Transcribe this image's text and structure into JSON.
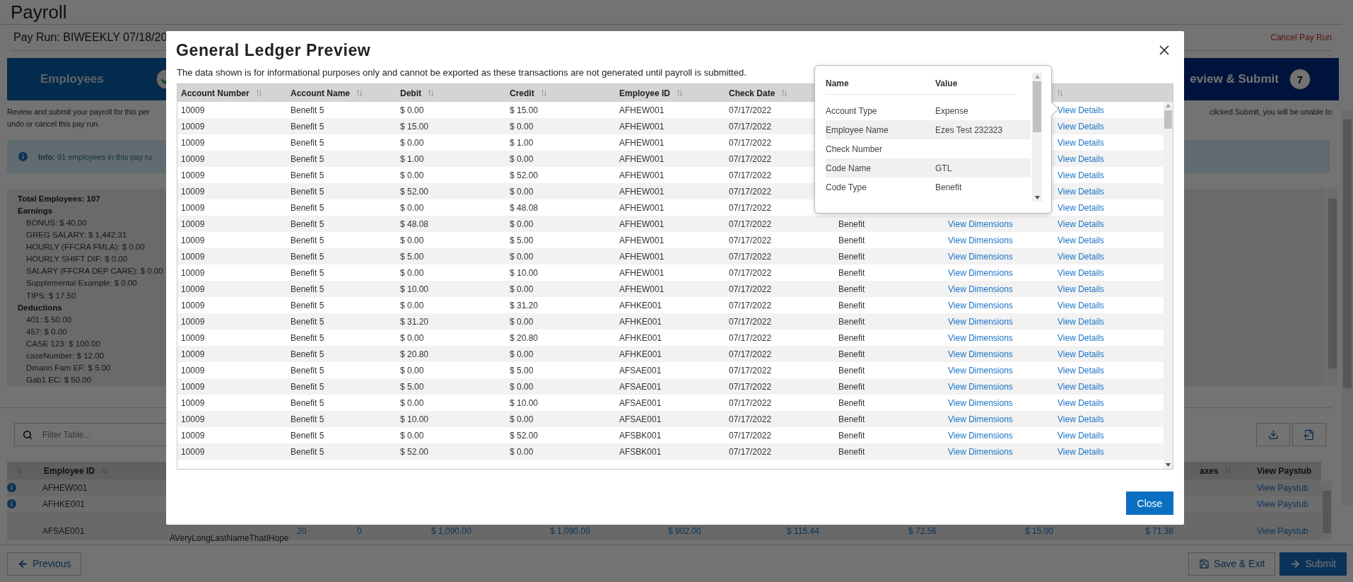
{
  "page": {
    "title": "Payroll"
  },
  "pay_run": {
    "title": "Pay Run: BIWEEKLY 07/18/20",
    "cancel_link": "Cancel Pay Run"
  },
  "steps": [
    {
      "label": "Employees",
      "completed": true
    },
    {
      "label": "eview & Submit",
      "number": "7",
      "completed": false
    }
  ],
  "intro_lines": [
    "Review and submit your payroll for this per",
    "undo or cancel this pay run."
  ],
  "intro_right": "clicked Submit, you will be unable to",
  "info": {
    "text": "**Info:** 91 employees in this pay ru"
  },
  "summary": {
    "total": "Total Employees: 107",
    "groups": [
      {
        "title": "Earnings",
        "items": [
          "BONUS: $ 40.00",
          "GREG SALARY: $ 1,442.31",
          "HOURLY (FFCRA FMLA): $ 0.00",
          "HOURLY SHIFT DIF: $ 0.00",
          "SALARY (FFCRA DEP CARE): $ 0.00",
          "Supplemental Example: $ 0.00",
          "TIPS: $ 17.50"
        ]
      },
      {
        "title": "Deductions",
        "items": [
          "401: $ 50.00",
          "457: $ 0.00",
          "CASE 123: $ 100.00",
          "caseNumber: $ 12.00",
          "Dmann Fam EF: $ 5.00",
          "Gab1 EC: $ 50.00"
        ]
      }
    ]
  },
  "filter": {
    "placeholder": "Filter Table..."
  },
  "employee_table": {
    "header": {
      "employee_id": "Employee ID",
      "taxes": "axes",
      "paystub": "View Paystub"
    },
    "rows": [
      {
        "flagged": true,
        "employee_id": "AFHEW001",
        "paystub_link": "View Paystub"
      },
      {
        "flagged": true,
        "employee_id": "AFHKE001",
        "paystub_link": "View Paystub"
      },
      {
        "flagged": false,
        "employee_id": "AFSAE001",
        "name": "AVeryLongLastNameThatIHope",
        "values": [
          "20",
          "0",
          "$ 1,090.00",
          "$ 1,090.00",
          "$ 902.00",
          "$ 115.44",
          "$ 72.56",
          "$ 15.00",
          "$ 71.38"
        ],
        "paystub_link": "View Paystub"
      }
    ]
  },
  "buttons": {
    "previous": "Previous",
    "save": "Save & Exit",
    "submit": "Submit"
  },
  "ledger_modal": {
    "title": "General Ledger Preview",
    "description": "The data shown is for informational purposes only and cannot be exported as these transactions are not generated until payroll is submitted.",
    "columns": [
      "Account Number",
      "Account Name",
      "Debit",
      "Credit",
      "Employee ID",
      "Check Date"
    ],
    "rows": [
      {
        "account_number": "10009",
        "account_name": "Benefit 5",
        "debit": "$ 0.00",
        "credit": "$ 15.00",
        "employee_id": "AFHEW001",
        "check_date": "07/17/2022",
        "details_link": "View Details"
      },
      {
        "account_number": "10009",
        "account_name": "Benefit 5",
        "debit": "$ 15.00",
        "credit": "$ 0.00",
        "employee_id": "AFHEW001",
        "check_date": "07/17/2022",
        "details_link": "View Details"
      },
      {
        "account_number": "10009",
        "account_name": "Benefit 5",
        "debit": "$ 0.00",
        "credit": "$ 1.00",
        "employee_id": "AFHEW001",
        "check_date": "07/17/2022",
        "details_link": "View Details"
      },
      {
        "account_number": "10009",
        "account_name": "Benefit 5",
        "debit": "$ 1.00",
        "credit": "$ 0.00",
        "employee_id": "AFHEW001",
        "check_date": "07/17/2022",
        "details_link": "View Details"
      },
      {
        "account_number": "10009",
        "account_name": "Benefit 5",
        "debit": "$ 0.00",
        "credit": "$ 52.00",
        "employee_id": "AFHEW001",
        "check_date": "07/17/2022",
        "details_link": "View Details"
      },
      {
        "account_number": "10009",
        "account_name": "Benefit 5",
        "debit": "$ 52.00",
        "credit": "$ 0.00",
        "employee_id": "AFHEW001",
        "check_date": "07/17/2022",
        "details_link": "View Details"
      },
      {
        "account_number": "10009",
        "account_name": "Benefit 5",
        "debit": "$ 0.00",
        "credit": "$ 48.08",
        "employee_id": "AFHEW001",
        "check_date": "07/17/2022",
        "details_link": "View Details"
      },
      {
        "account_number": "10009",
        "account_name": "Benefit 5",
        "debit": "$ 48.08",
        "credit": "$ 0.00",
        "employee_id": "AFHEW001",
        "check_date": "07/17/2022",
        "code_type": "Benefit",
        "dimensions_link": "View Dimensions",
        "details_link": "View Details"
      },
      {
        "account_number": "10009",
        "account_name": "Benefit 5",
        "debit": "$ 0.00",
        "credit": "$ 5.00",
        "employee_id": "AFHEW001",
        "check_date": "07/17/2022",
        "code_type": "Benefit",
        "dimensions_link": "View Dimensions",
        "details_link": "View Details"
      },
      {
        "account_number": "10009",
        "account_name": "Benefit 5",
        "debit": "$ 5.00",
        "credit": "$ 0.00",
        "employee_id": "AFHEW001",
        "check_date": "07/17/2022",
        "code_type": "Benefit",
        "dimensions_link": "View Dimensions",
        "details_link": "View Details"
      },
      {
        "account_number": "10009",
        "account_name": "Benefit 5",
        "debit": "$ 0.00",
        "credit": "$ 10.00",
        "employee_id": "AFHEW001",
        "check_date": "07/17/2022",
        "code_type": "Benefit",
        "dimensions_link": "View Dimensions",
        "details_link": "View Details"
      },
      {
        "account_number": "10009",
        "account_name": "Benefit 5",
        "debit": "$ 10.00",
        "credit": "$ 0.00",
        "employee_id": "AFHEW001",
        "check_date": "07/17/2022",
        "code_type": "Benefit",
        "dimensions_link": "View Dimensions",
        "details_link": "View Details"
      },
      {
        "account_number": "10009",
        "account_name": "Benefit 5",
        "debit": "$ 0.00",
        "credit": "$ 31.20",
        "employee_id": "AFHKE001",
        "check_date": "07/17/2022",
        "code_type": "Benefit",
        "dimensions_link": "View Dimensions",
        "details_link": "View Details"
      },
      {
        "account_number": "10009",
        "account_name": "Benefit 5",
        "debit": "$ 31.20",
        "credit": "$ 0.00",
        "employee_id": "AFHKE001",
        "check_date": "07/17/2022",
        "code_type": "Benefit",
        "dimensions_link": "View Dimensions",
        "details_link": "View Details"
      },
      {
        "account_number": "10009",
        "account_name": "Benefit 5",
        "debit": "$ 0.00",
        "credit": "$ 20.80",
        "employee_id": "AFHKE001",
        "check_date": "07/17/2022",
        "code_type": "Benefit",
        "dimensions_link": "View Dimensions",
        "details_link": "View Details"
      },
      {
        "account_number": "10009",
        "account_name": "Benefit 5",
        "debit": "$ 20.80",
        "credit": "$ 0.00",
        "employee_id": "AFHKE001",
        "check_date": "07/17/2022",
        "code_type": "Benefit",
        "dimensions_link": "View Dimensions",
        "details_link": "View Details"
      },
      {
        "account_number": "10009",
        "account_name": "Benefit 5",
        "debit": "$ 0.00",
        "credit": "$ 5.00",
        "employee_id": "AFSAE001",
        "check_date": "07/17/2022",
        "code_type": "Benefit",
        "dimensions_link": "View Dimensions",
        "details_link": "View Details"
      },
      {
        "account_number": "10009",
        "account_name": "Benefit 5",
        "debit": "$ 5.00",
        "credit": "$ 0.00",
        "employee_id": "AFSAE001",
        "check_date": "07/17/2022",
        "code_type": "Benefit",
        "dimensions_link": "View Dimensions",
        "details_link": "View Details"
      },
      {
        "account_number": "10009",
        "account_name": "Benefit 5",
        "debit": "$ 0.00",
        "credit": "$ 10.00",
        "employee_id": "AFSAE001",
        "check_date": "07/17/2022",
        "code_type": "Benefit",
        "dimensions_link": "View Dimensions",
        "details_link": "View Details"
      },
      {
        "account_number": "10009",
        "account_name": "Benefit 5",
        "debit": "$ 10.00",
        "credit": "$ 0.00",
        "employee_id": "AFSAE001",
        "check_date": "07/17/2022",
        "code_type": "Benefit",
        "dimensions_link": "View Dimensions",
        "details_link": "View Details"
      },
      {
        "account_number": "10009",
        "account_name": "Benefit 5",
        "debit": "$ 0.00",
        "credit": "$ 52.00",
        "employee_id": "AFSBK001",
        "check_date": "07/17/2022",
        "code_type": "Benefit",
        "dimensions_link": "View Dimensions",
        "details_link": "View Details"
      },
      {
        "account_number": "10009",
        "account_name": "Benefit 5",
        "debit": "$ 52.00",
        "credit": "$ 0.00",
        "employee_id": "AFSBK001",
        "check_date": "07/17/2022",
        "code_type": "Benefit",
        "dimensions_link": "View Dimensions",
        "details_link": "View Details"
      }
    ],
    "close_button": "Close",
    "details_popover": {
      "columns": [
        "Name",
        "Value"
      ],
      "rows": [
        {
          "name": "Account Type",
          "value": "Expense"
        },
        {
          "name": "Employee Name",
          "value": "Ezes Test 232323"
        },
        {
          "name": "Check Number"
        },
        {
          "name": "Code Name",
          "value": "GTL"
        },
        {
          "name": "Code Type",
          "value": "Benefit"
        }
      ]
    }
  }
}
